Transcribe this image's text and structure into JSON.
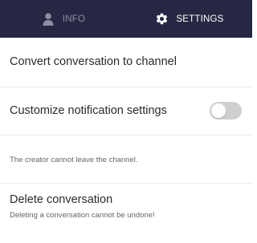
{
  "tabs": {
    "info": {
      "label": "INFO",
      "icon": "user-icon",
      "active": false
    },
    "settings": {
      "label": "SETTINGS",
      "icon": "gear-icon",
      "active": true
    }
  },
  "settings": {
    "convert_label": "Convert conversation to channel",
    "notifications_label": "Customize notification settings",
    "notifications_enabled": false,
    "creator_note": "The creator cannot leave the channel.",
    "delete_label": "Delete conversation",
    "delete_warning": "Deleting a conversation cannot be undone!"
  },
  "colors": {
    "header_bg": "#262843",
    "tab_inactive": "#8c8ea3",
    "tab_active": "#ffffff",
    "toggle_off": "#cfcfcf",
    "divider": "#ececec"
  }
}
